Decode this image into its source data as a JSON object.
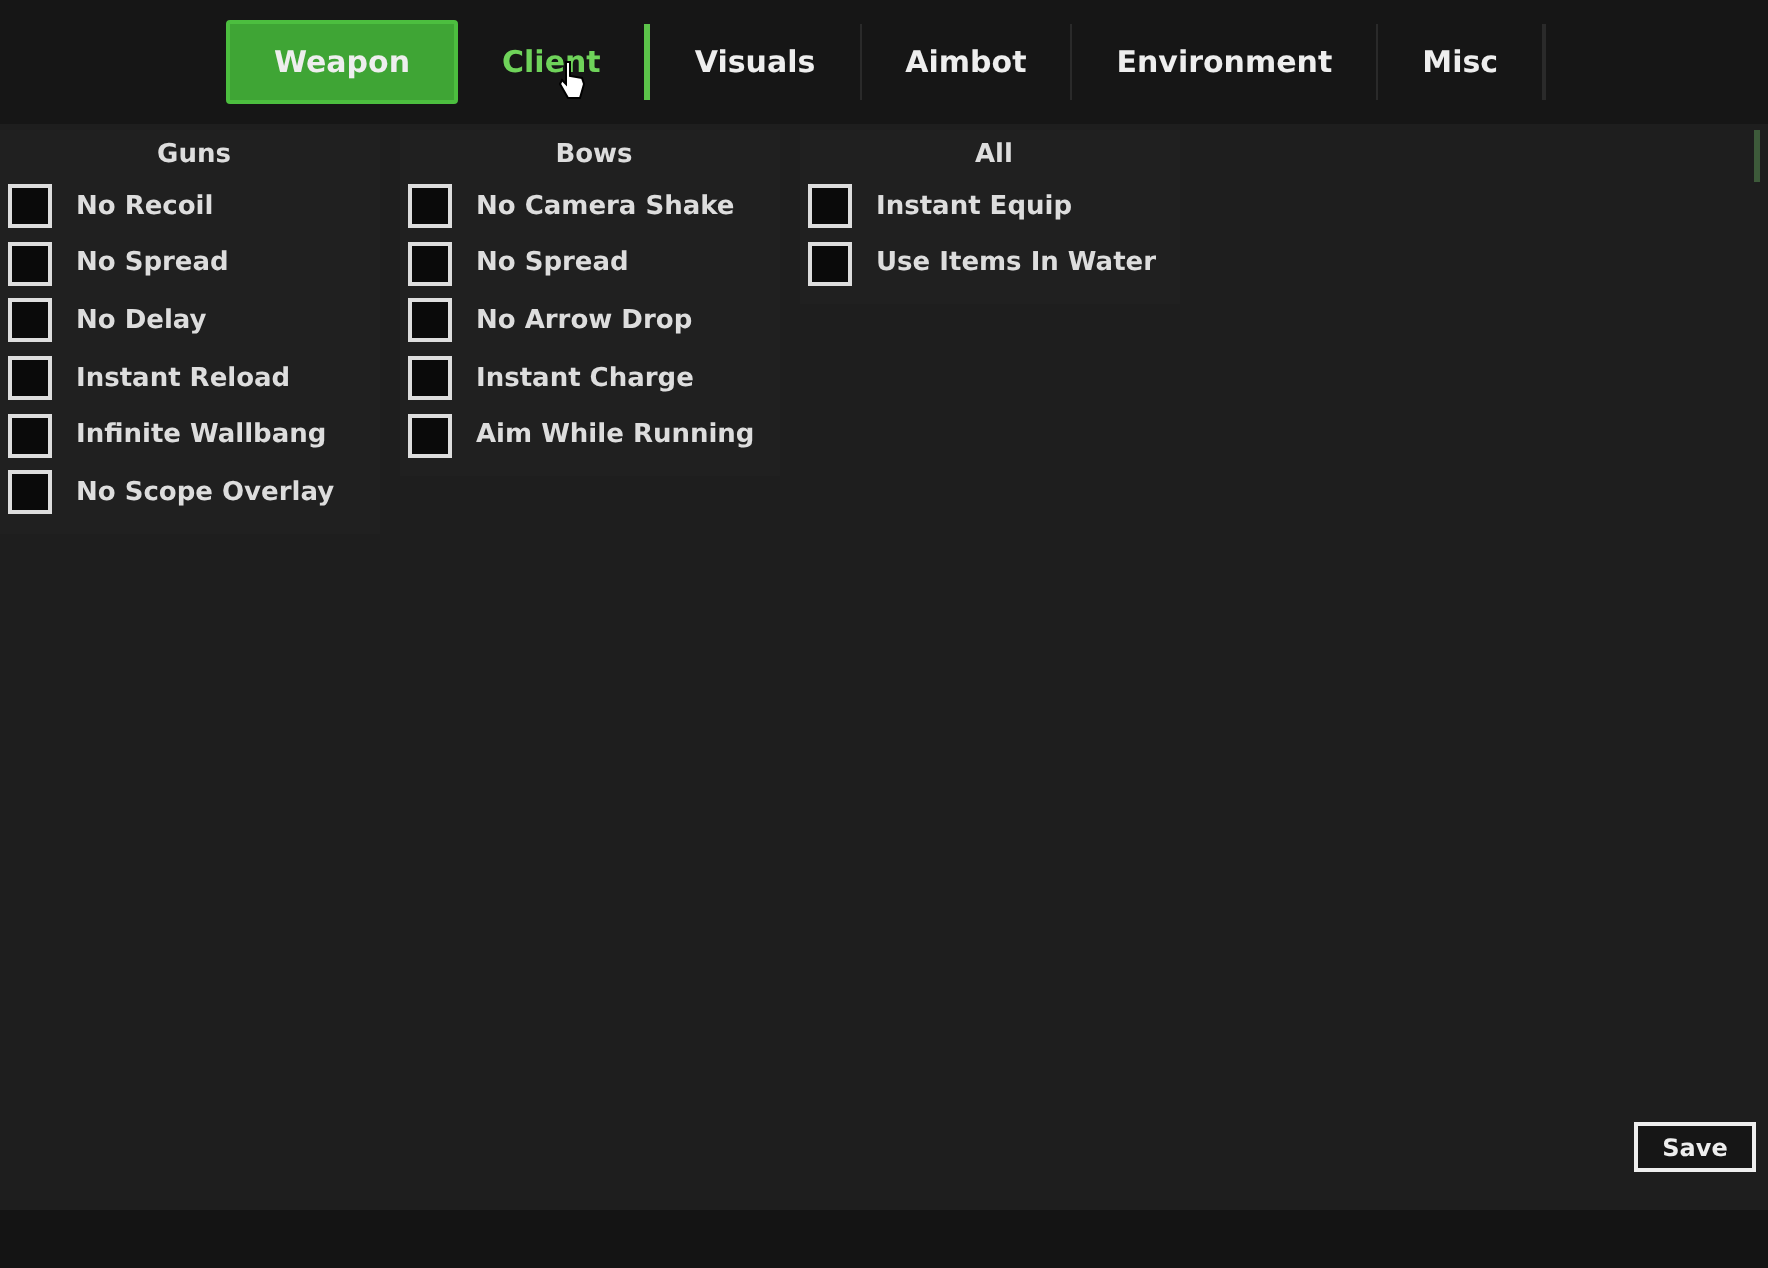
{
  "tabs": [
    {
      "label": "Weapon",
      "selected": true,
      "hovered": false
    },
    {
      "label": "Client",
      "selected": false,
      "hovered": true
    },
    {
      "label": "Visuals",
      "selected": false,
      "hovered": false
    },
    {
      "label": "Aimbot",
      "selected": false,
      "hovered": false
    },
    {
      "label": "Environment",
      "selected": false,
      "hovered": false
    },
    {
      "label": "Misc",
      "selected": false,
      "hovered": false
    }
  ],
  "sections": [
    {
      "title": "Guns",
      "options": [
        {
          "label": "No Recoil",
          "checked": false
        },
        {
          "label": "No Spread",
          "checked": false
        },
        {
          "label": "No Delay",
          "checked": false
        },
        {
          "label": "Instant Reload",
          "checked": false
        },
        {
          "label": "Infinite Wallbang",
          "checked": false
        },
        {
          "label": "No Scope Overlay",
          "checked": false
        }
      ]
    },
    {
      "title": "Bows",
      "options": [
        {
          "label": "No Camera Shake",
          "checked": false
        },
        {
          "label": "No Spread",
          "checked": false
        },
        {
          "label": "No Arrow Drop",
          "checked": false
        },
        {
          "label": "Instant Charge",
          "checked": false
        },
        {
          "label": "Aim While Running",
          "checked": false
        }
      ]
    },
    {
      "title": "All",
      "options": [
        {
          "label": "Instant Equip",
          "checked": false
        },
        {
          "label": "Use Items In Water",
          "checked": false
        }
      ]
    }
  ],
  "save_button": "Save"
}
